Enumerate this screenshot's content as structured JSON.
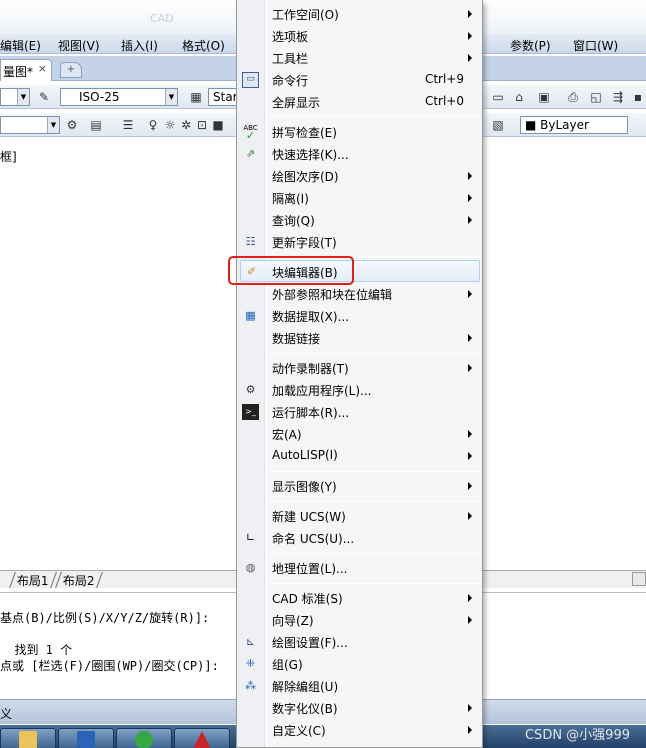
{
  "app": {
    "title_fragment": "CAD",
    "menubar": [
      "编辑(E)",
      "视图(V)",
      "插入(I)",
      "格式(O)",
      "参数(P)",
      "窗口(W)"
    ],
    "doc_tab": "量图*",
    "doc_tab_close": "×",
    "style_combo": "ISO-25",
    "style_combo2": "Star",
    "layer_combo": "ByLayer",
    "canvas_text": "框]",
    "layout_tabs": [
      "布局1",
      "布局2"
    ],
    "command_lines": [
      "基点(B)/比例(S)/X/Y/Z/旋转(R)]:",
      "  找到 1 个",
      "点或 [栏选(F)/圈围(WP)/圈交(CP)]:"
    ],
    "status_text": "义",
    "watermark": "CSDN @小强999"
  },
  "menu": {
    "items": [
      {
        "label": "工作空间(O)",
        "submenu": true
      },
      {
        "label": "选项板",
        "submenu": true
      },
      {
        "label": "工具栏",
        "submenu": true
      },
      {
        "label": "命令行",
        "shortcut": "Ctrl+9",
        "icon": "command-line-icon"
      },
      {
        "label": "全屏显示",
        "shortcut": "Ctrl+0"
      },
      {
        "label": "拼写检查(E)",
        "icon": "spell-check-icon"
      },
      {
        "label": "快速选择(K)...",
        "icon": "quick-select-icon"
      },
      {
        "label": "绘图次序(D)",
        "submenu": true
      },
      {
        "label": "隔离(I)",
        "submenu": true
      },
      {
        "label": "查询(Q)",
        "submenu": true
      },
      {
        "label": "更新字段(T)",
        "icon": "update-field-icon"
      },
      {
        "label": "块编辑器(B)",
        "icon": "block-editor-icon",
        "highlighted": true
      },
      {
        "label": "外部参照和块在位编辑",
        "submenu": true
      },
      {
        "label": "数据提取(X)...",
        "icon": "data-extract-icon"
      },
      {
        "label": "数据链接",
        "submenu": true
      },
      {
        "label": "动作录制器(T)",
        "submenu": true
      },
      {
        "label": "加载应用程序(L)...",
        "icon": "load-app-icon"
      },
      {
        "label": "运行脚本(R)...",
        "icon": "run-script-icon"
      },
      {
        "label": "宏(A)",
        "submenu": true
      },
      {
        "label": "AutoLISP(I)",
        "submenu": true
      },
      {
        "label": "显示图像(Y)",
        "submenu": true
      },
      {
        "label": "新建 UCS(W)",
        "submenu": true
      },
      {
        "label": "命名 UCS(U)...",
        "icon": "named-ucs-icon"
      },
      {
        "label": "地理位置(L)...",
        "icon": "globe-icon"
      },
      {
        "label": "CAD 标准(S)",
        "submenu": true
      },
      {
        "label": "向导(Z)",
        "submenu": true
      },
      {
        "label": "绘图设置(F)...",
        "icon": "drafting-settings-icon"
      },
      {
        "label": "组(G)",
        "icon": "group-icon"
      },
      {
        "label": "解除编组(U)",
        "icon": "ungroup-icon"
      },
      {
        "label": "数字化仪(B)",
        "submenu": true
      },
      {
        "label": "自定义(C)",
        "submenu": true
      }
    ]
  },
  "colors": {
    "highlight_border": "#aecff7",
    "annotation_red": "#e0201b"
  }
}
